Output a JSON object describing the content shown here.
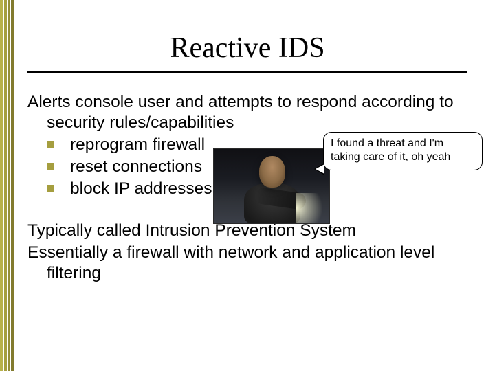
{
  "title": "Reactive IDS",
  "intro": "Alerts console user and attempts to respond according to security rules/capabilities",
  "bullets": [
    "reprogram firewall",
    "reset connections",
    "block IP addresses"
  ],
  "speech_bubble": "I found a threat and I'm taking care of it, oh yeah",
  "closing": [
    "Typically called Intrusion Prevention System",
    "Essentially a firewall with network and application level filtering"
  ],
  "image_alt": "Person pointing a flashlight toward the viewer in a dark scene"
}
